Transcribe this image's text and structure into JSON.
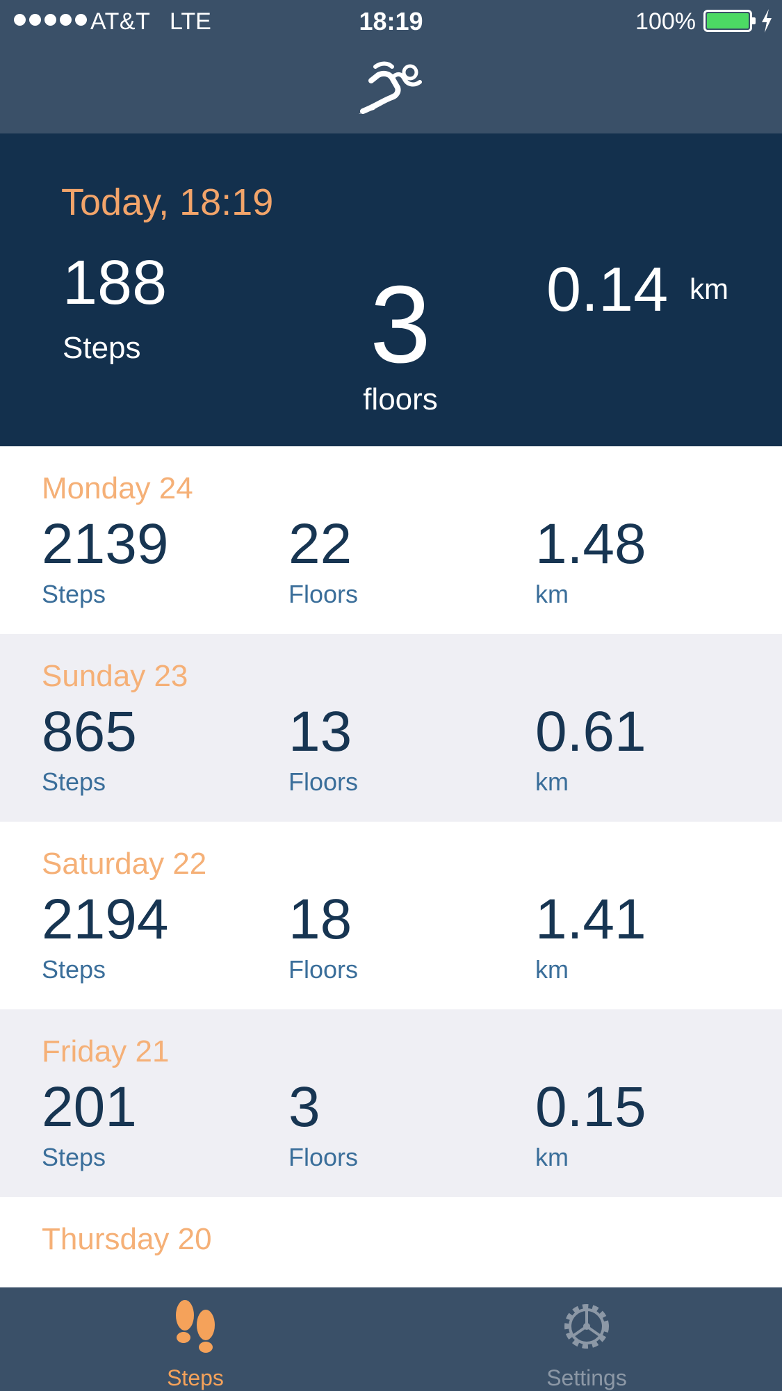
{
  "status_bar": {
    "carrier": "AT&T",
    "network": "LTE",
    "time": "18:19",
    "battery_percent": "100%",
    "signal_bars": 5,
    "battery_level": 1.0,
    "charging": true
  },
  "nav": {
    "logo_icon": "runner-icon"
  },
  "today": {
    "title": "Today, 18:19",
    "steps_value": "188",
    "steps_label": "Steps",
    "floors_value": "3",
    "floors_label": "floors",
    "distance_value": "0.14",
    "distance_unit": "km"
  },
  "days": [
    {
      "label": "Monday 24",
      "steps": "2139",
      "steps_label": "Steps",
      "floors": "22",
      "floors_label": "Floors",
      "distance": "1.48",
      "distance_label": "km"
    },
    {
      "label": "Sunday 23",
      "steps": "865",
      "steps_label": "Steps",
      "floors": "13",
      "floors_label": "Floors",
      "distance": "0.61",
      "distance_label": "km"
    },
    {
      "label": "Saturday 22",
      "steps": "2194",
      "steps_label": "Steps",
      "floors": "18",
      "floors_label": "Floors",
      "distance": "1.41",
      "distance_label": "km"
    },
    {
      "label": "Friday 21",
      "steps": "201",
      "steps_label": "Steps",
      "floors": "3",
      "floors_label": "Floors",
      "distance": "0.15",
      "distance_label": "km"
    },
    {
      "label": "Thursday 20",
      "steps": "",
      "steps_label": "",
      "floors": "",
      "floors_label": "",
      "distance": "",
      "distance_label": ""
    }
  ],
  "tabs": [
    {
      "label": "Steps",
      "icon": "footprints-icon",
      "selected": true,
      "color": "#f5a25a"
    },
    {
      "label": "Settings",
      "icon": "gear-icon",
      "selected": false,
      "color": "#8c98a6"
    }
  ],
  "colors": {
    "header_bg": "#3a5068",
    "summary_bg": "#13304d",
    "accent_orange": "#f2a46a",
    "value_navy": "#173552",
    "label_blue": "#3a6e9a",
    "row_alt_bg": "#efeff4",
    "battery_green": "#4cd964"
  }
}
